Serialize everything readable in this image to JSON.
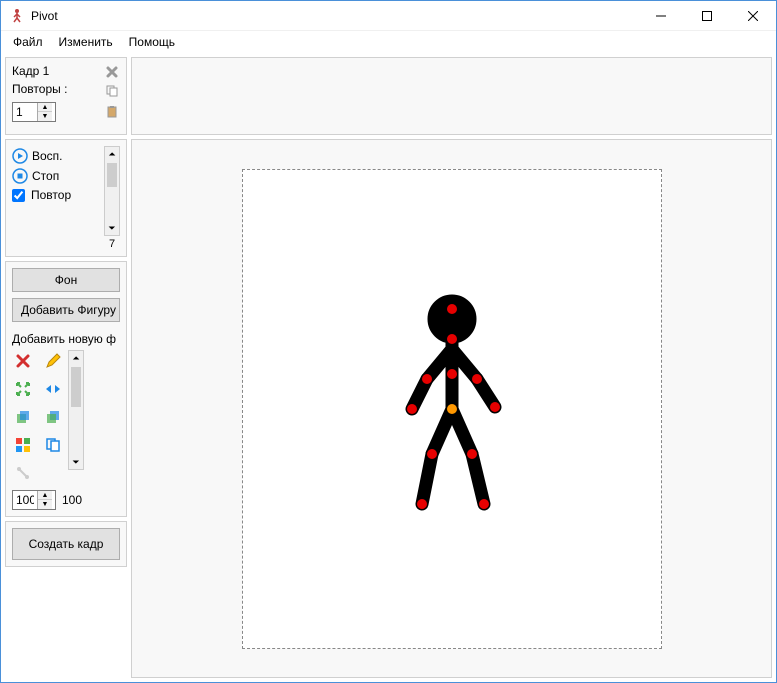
{
  "window": {
    "title": "Pivot"
  },
  "menu": {
    "file": "Файл",
    "edit": "Изменить",
    "help": "Помощь"
  },
  "frame_panel": {
    "frame_label": "Кадр 1",
    "repeat_label": "Повторы :",
    "repeat_value": "1"
  },
  "playback": {
    "play": "Восп.",
    "stop": "Стоп",
    "loop": "Повтор",
    "speed": "7"
  },
  "tools": {
    "background_btn": "Фон",
    "add_figure_btn": "Добавить Фигуру",
    "add_new_label": "Добавить новую ф",
    "scale_value": "100",
    "scale_display": "100",
    "create_frame_btn": "Создать кадр"
  },
  "icons": {
    "delete_frame": "delete-frame-icon",
    "copy": "copy-icon",
    "paste": "paste-icon",
    "play": "play-icon",
    "stop": "stop-icon",
    "delete": "delete-icon",
    "edit": "pencil-icon",
    "center": "center-icon",
    "flip": "flip-icon",
    "color": "color-icon",
    "duplicate": "duplicate-icon",
    "join": "join-icon"
  }
}
